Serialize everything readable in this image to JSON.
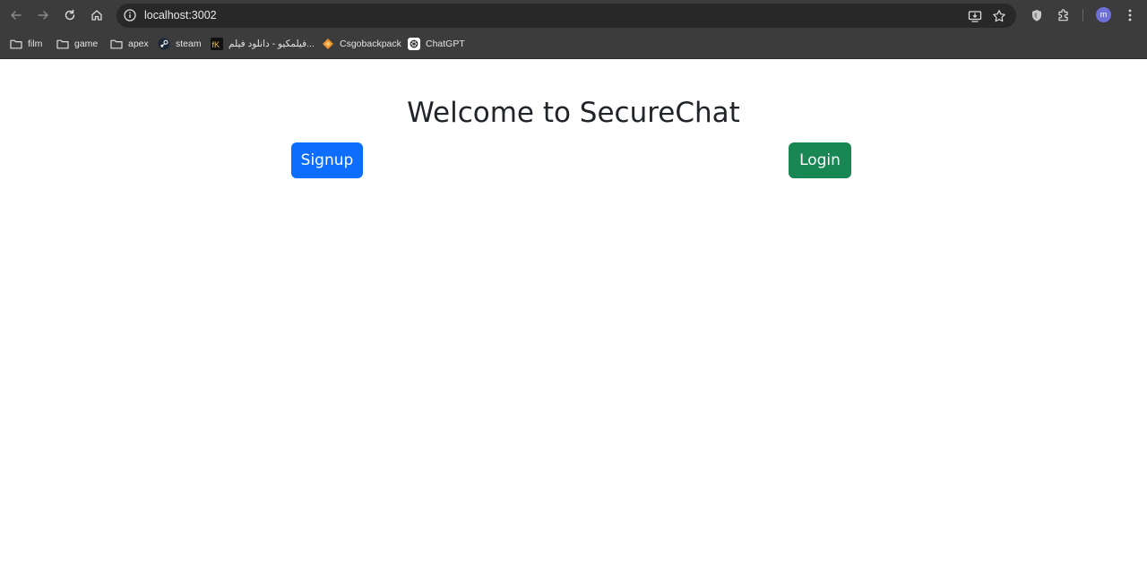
{
  "browser": {
    "url": "localhost:3002",
    "profile_initial": "m",
    "bookmarks": [
      {
        "label": "film",
        "icon": "folder-icon"
      },
      {
        "label": "game",
        "icon": "folder-icon"
      },
      {
        "label": "apex",
        "icon": "folder-icon"
      },
      {
        "label": "steam",
        "icon": "steam-icon"
      },
      {
        "label": "فیلمکیو - دانلود فیلم...",
        "icon": "filmkio-icon"
      },
      {
        "label": "Csgobackpack",
        "icon": "csgobackpack-icon"
      },
      {
        "label": "ChatGPT",
        "icon": "chatgpt-icon"
      }
    ]
  },
  "page": {
    "title": "Welcome to SecureChat",
    "signup_label": "Signup",
    "login_label": "Login"
  },
  "colors": {
    "signup_button": "#0d6efd",
    "login_button": "#198754",
    "title_text": "#212529",
    "browser_chrome": "#3c3c3c"
  }
}
